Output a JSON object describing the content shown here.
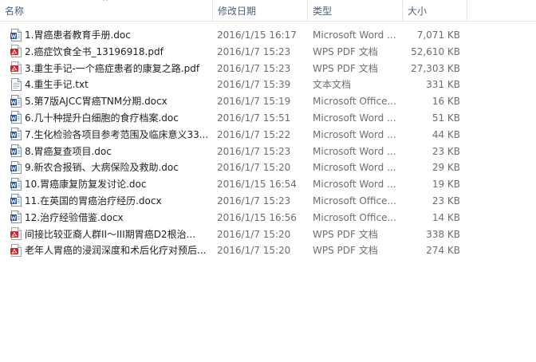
{
  "columns": {
    "name": "名称",
    "date": "修改日期",
    "type": "类型",
    "size": "大小"
  },
  "sort_indicator": "^",
  "files": [
    {
      "icon": "word-document-icon",
      "name": "1.胃癌患者教育手册.doc",
      "date": "2016/1/15 16:17",
      "type": "Microsoft Word ...",
      "size": "7,071 KB"
    },
    {
      "icon": "pdf-document-icon",
      "name": "2.癌症饮食全书_13196918.pdf",
      "date": "2016/1/7 15:23",
      "type": "WPS PDF 文档",
      "size": "52,610 KB"
    },
    {
      "icon": "pdf-document-icon",
      "name": "3.重生手记-一个癌症患者的康复之路.pdf",
      "date": "2016/1/7 15:23",
      "type": "WPS PDF 文档",
      "size": "27,303 KB"
    },
    {
      "icon": "text-document-icon",
      "name": "4.重生手记.txt",
      "date": "2016/1/7 15:39",
      "type": "文本文档",
      "size": "331 KB"
    },
    {
      "icon": "word-document-icon",
      "name": "5.第7版AJCC胃癌TNM分期.docx",
      "date": "2016/1/7 15:19",
      "type": "Microsoft Office...",
      "size": "16 KB"
    },
    {
      "icon": "word-document-icon",
      "name": "6.几十种提升白细胞的食疗档案.doc",
      "date": "2016/1/7 15:51",
      "type": "Microsoft Word ...",
      "size": "51 KB"
    },
    {
      "icon": "word-document-icon",
      "name": "7.生化检验各项目参考范围及临床意义33...",
      "date": "2016/1/7 15:22",
      "type": "Microsoft Word ...",
      "size": "44 KB"
    },
    {
      "icon": "word-document-icon",
      "name": "8.胃癌复查项目.doc",
      "date": "2016/1/7 15:23",
      "type": "Microsoft Word ...",
      "size": "23 KB"
    },
    {
      "icon": "word-document-icon",
      "name": "9.新农合报销、大病保险及救助.doc",
      "date": "2016/1/7 15:20",
      "type": "Microsoft Word ...",
      "size": "29 KB"
    },
    {
      "icon": "word-document-icon",
      "name": "10.胃癌康复防复发讨论.doc",
      "date": "2016/1/15 16:54",
      "type": "Microsoft Word ...",
      "size": "19 KB"
    },
    {
      "icon": "word-document-icon",
      "name": "11.在英国的胃癌治疗经历.docx",
      "date": "2016/1/7 15:23",
      "type": "Microsoft Office...",
      "size": "23 KB"
    },
    {
      "icon": "word-document-icon",
      "name": "12.治疗经验借鉴.docx",
      "date": "2016/1/15 16:56",
      "type": "Microsoft Office...",
      "size": "14 KB"
    },
    {
      "icon": "pdf-document-icon",
      "name": "间接比较亚裔人群II～III期胃癌D2根治...",
      "date": "2016/1/7 15:20",
      "type": "WPS PDF 文档",
      "size": "338 KB"
    },
    {
      "icon": "pdf-document-icon",
      "name": "老年人胃癌的浸润深度和术后化疗对预后...",
      "date": "2016/1/7 15:20",
      "type": "WPS PDF 文档",
      "size": "274 KB"
    }
  ]
}
